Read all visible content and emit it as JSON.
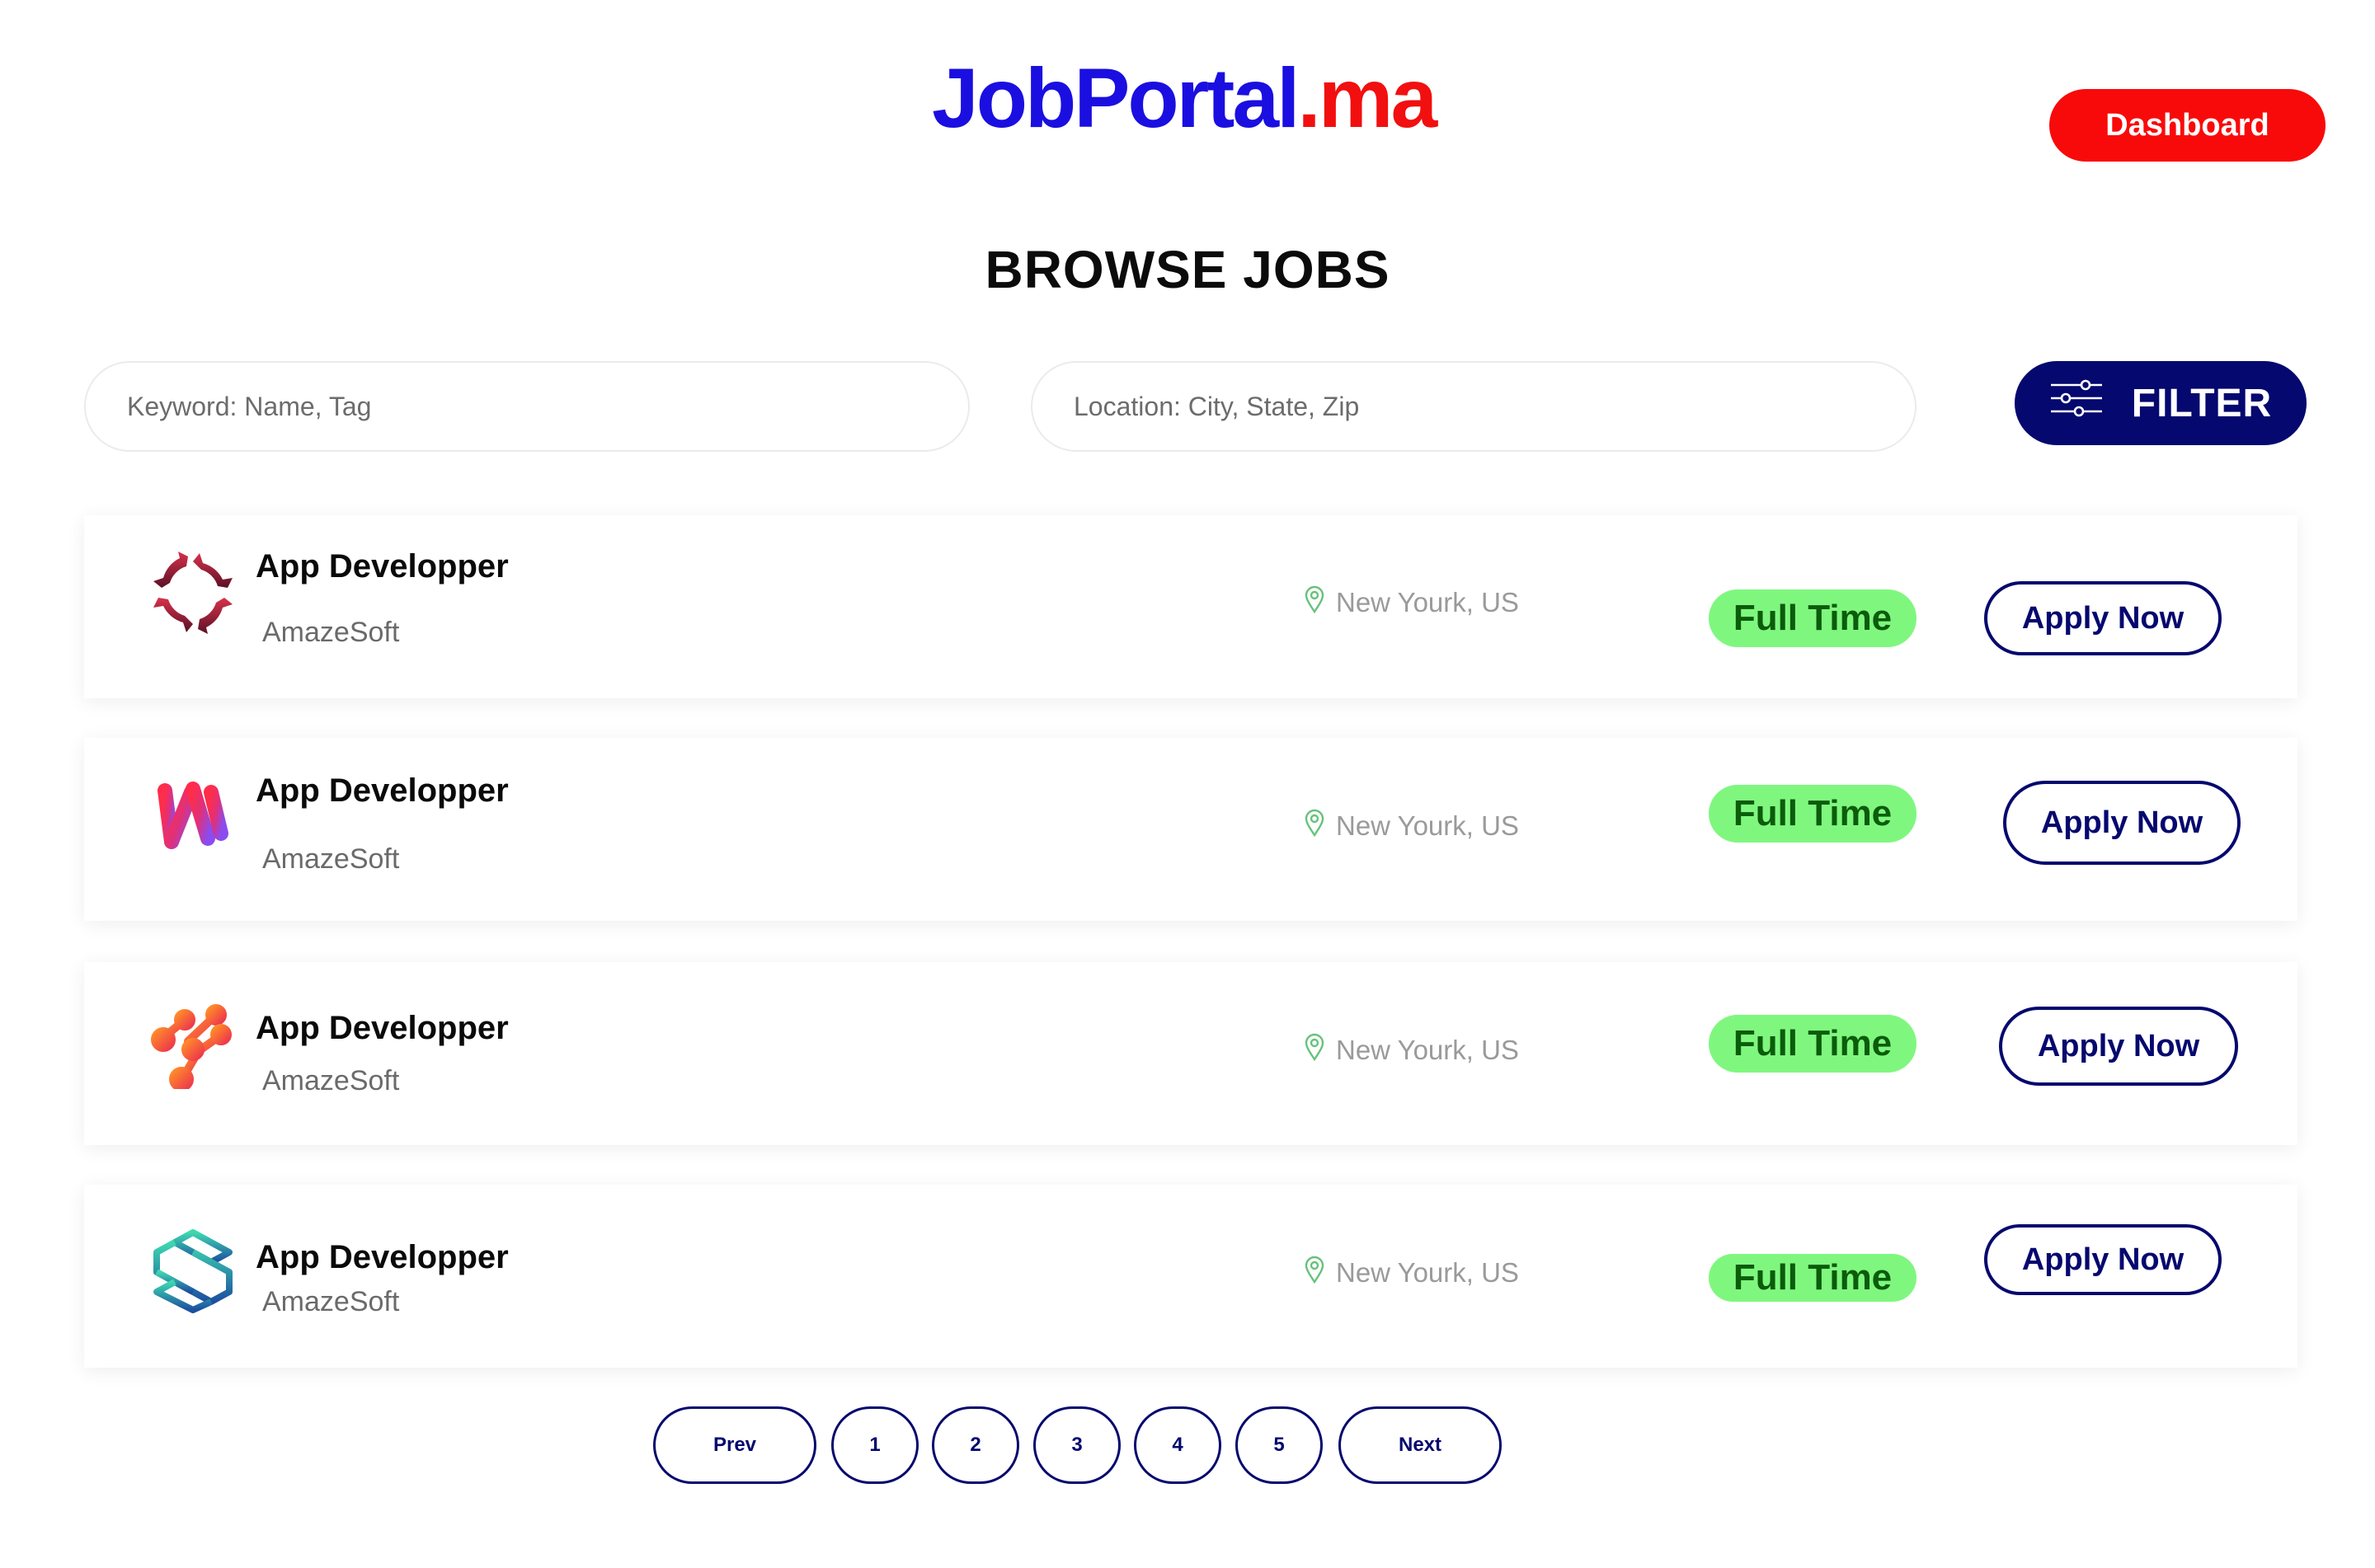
{
  "brand": {
    "part1": "JobPortal",
    "part2": ".ma",
    "color_primary": "#1a0fe0",
    "color_accent": "#f20f0f"
  },
  "header": {
    "dashboard_label": "Dashboard"
  },
  "page": {
    "title": "BROWSE JOBS"
  },
  "search": {
    "keyword_placeholder": "Keyword: Name, Tag",
    "location_placeholder": "Location: City, State, Zip",
    "filter_label": "FILTER",
    "filter_icon": "sliders-icon"
  },
  "jobs": [
    {
      "title": "App Developper",
      "company": "AmazeSoft",
      "location": "New Yourk, US",
      "type": "Full Time",
      "apply_label": "Apply Now",
      "logo_icon": "gear-arrows-logo"
    },
    {
      "title": "App Developper",
      "company": "AmazeSoft",
      "location": "New Yourk, US",
      "type": "Full Time",
      "apply_label": "Apply Now",
      "logo_icon": "gradient-m-logo"
    },
    {
      "title": "App Developper",
      "company": "AmazeSoft",
      "location": "New Yourk, US",
      "type": "Full Time",
      "apply_label": "Apply Now",
      "logo_icon": "molecule-dots-logo"
    },
    {
      "title": "App Developper",
      "company": "AmazeSoft",
      "location": "New Yourk, US",
      "type": "Full Time",
      "apply_label": "Apply Now",
      "logo_icon": "layered-s-logo"
    }
  ],
  "pagination": {
    "prev": "Prev",
    "pages": [
      "1",
      "2",
      "3",
      "4",
      "5"
    ],
    "next": "Next"
  },
  "colors": {
    "navy": "#05086e",
    "badge_green": "#7ff77f",
    "badge_text": "#0b5c0b",
    "danger_red": "#f90a0a"
  }
}
